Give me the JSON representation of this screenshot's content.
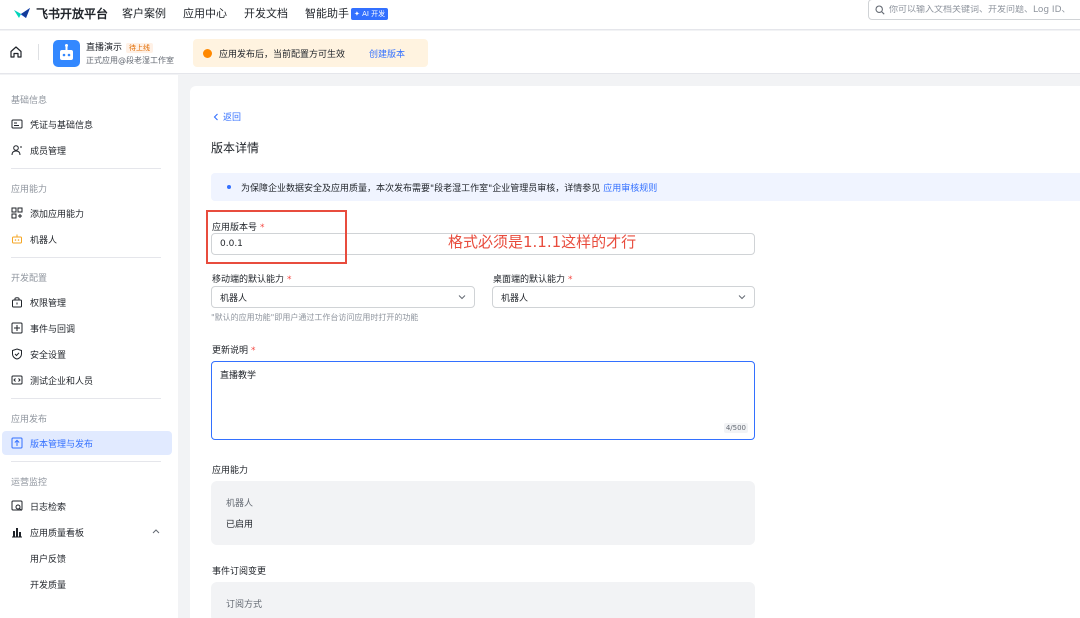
{
  "topnav": {
    "brand": "飞书开放平台",
    "links": [
      "客户案例",
      "应用中心",
      "开发文档",
      "智能助手"
    ],
    "ai_badge": "✦ AI 开发",
    "search_placeholder": "你可以输入文档关键词、开发问题、Log ID、"
  },
  "appbar": {
    "app_name": "直播演示",
    "status": "待上线",
    "app_sub": "正式应用@段老湿工作室",
    "notice": "应用发布后，当前配置方可生效",
    "notice_action": "创建版本"
  },
  "sidebar": {
    "groups": [
      "基础信息",
      "应用能力",
      "开发配置",
      "应用发布",
      "运营监控"
    ],
    "items": [
      {
        "label": "凭证与基础信息",
        "icon": "credential-icon"
      },
      {
        "label": "成员管理",
        "icon": "member-icon"
      },
      {
        "label": "添加应用能力",
        "icon": "add-capability-icon"
      },
      {
        "label": "机器人",
        "icon": "robot-icon"
      },
      {
        "label": "权限管理",
        "icon": "permission-icon"
      },
      {
        "label": "事件与回调",
        "icon": "event-icon"
      },
      {
        "label": "安全设置",
        "icon": "shield-icon"
      },
      {
        "label": "测试企业和人员",
        "icon": "test-icon"
      },
      {
        "label": "版本管理与发布",
        "icon": "version-icon"
      },
      {
        "label": "日志检索",
        "icon": "log-icon"
      },
      {
        "label": "应用质量看板",
        "icon": "dashboard-icon"
      },
      {
        "label": "用户反馈",
        "icon": ""
      },
      {
        "label": "开发质量",
        "icon": ""
      }
    ]
  },
  "main": {
    "back": "返回",
    "title": "版本详情",
    "info": "为保障企业数据安全及应用质量，本次发布需要\"段老湿工作室\"企业管理员审核，详情参见",
    "info_link": "应用审核规则",
    "version_label": "应用版本号",
    "version_value": "0.0.1",
    "mobile_label": "移动端的默认能力",
    "mobile_value": "机器人",
    "desktop_label": "桌面端的默认能力",
    "desktop_value": "机器人",
    "default_hint": "\"默认的应用功能\"即用户通过工作台访问应用时打开的功能",
    "update_label": "更新说明",
    "update_value": "直播教学",
    "update_counter": "4/500",
    "capability_title": "应用能力",
    "capability_name": "机器人",
    "capability_status": "已启用",
    "event_title": "事件订阅变更",
    "event_label": "订阅方式"
  },
  "annotation": {
    "text": "格式必须是1.1.1这样的才行",
    "color": "#e84c3d"
  },
  "colors": {
    "accent": "#3370ff",
    "required": "#f54a45",
    "notice_bg": "#fff3e0",
    "active_bg": "#e1eaff"
  }
}
